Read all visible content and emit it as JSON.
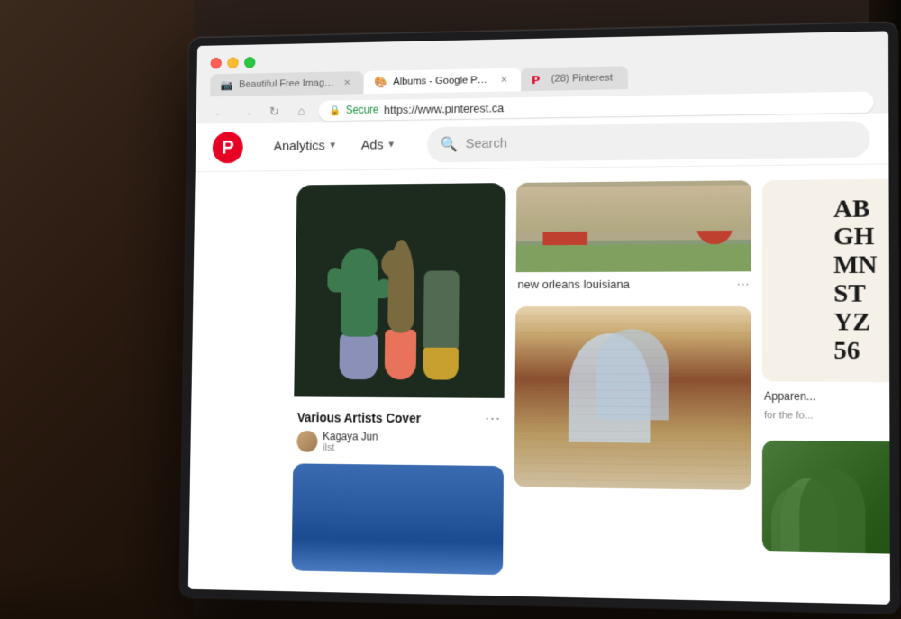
{
  "scene": {
    "bg": "#2a1f1a"
  },
  "browser": {
    "tabs": [
      {
        "id": "tab-unsplash",
        "title": "Beautiful Free Images & Pictur...",
        "icon": "camera-icon",
        "active": false,
        "has_close": true
      },
      {
        "id": "tab-google-photos",
        "title": "Albums - Google Photos",
        "icon": "photos-icon",
        "active": false,
        "has_close": true
      },
      {
        "id": "tab-pinterest",
        "title": "(28) Pinterest",
        "icon": "pinterest-icon",
        "active": true,
        "has_close": false
      }
    ],
    "address_bar": {
      "secure_label": "Secure",
      "url": "https://www.pinterest.ca"
    },
    "nav": {
      "back_enabled": true,
      "forward_enabled": false
    }
  },
  "pinterest": {
    "logo": "P",
    "nav_items": [
      {
        "label": "Analytics",
        "has_dropdown": true
      },
      {
        "label": "Ads",
        "has_dropdown": true
      }
    ],
    "search_placeholder": "Search",
    "pins": [
      {
        "id": "pin-artists-cover",
        "title": "Various Artists Cover",
        "author_name": "Kagaya Jun",
        "author_sub": "ilst",
        "col": 1,
        "type": "illustration"
      },
      {
        "id": "pin-new-orleans",
        "title": "new orleans louisiana",
        "col": 2,
        "type": "photo-new-orleans"
      },
      {
        "id": "pin-arch",
        "title": "",
        "col": 2,
        "type": "photo-arch"
      },
      {
        "id": "pin-typography",
        "title": "Apparently...",
        "subtitle": "for the fo...",
        "col": 3,
        "type": "typography"
      },
      {
        "id": "pin-greenery",
        "title": "",
        "col": 3,
        "type": "greenery"
      }
    ],
    "typography_text": [
      "AB",
      "GH",
      "MN",
      "ST",
      "Y  Z",
      "5 6"
    ]
  }
}
